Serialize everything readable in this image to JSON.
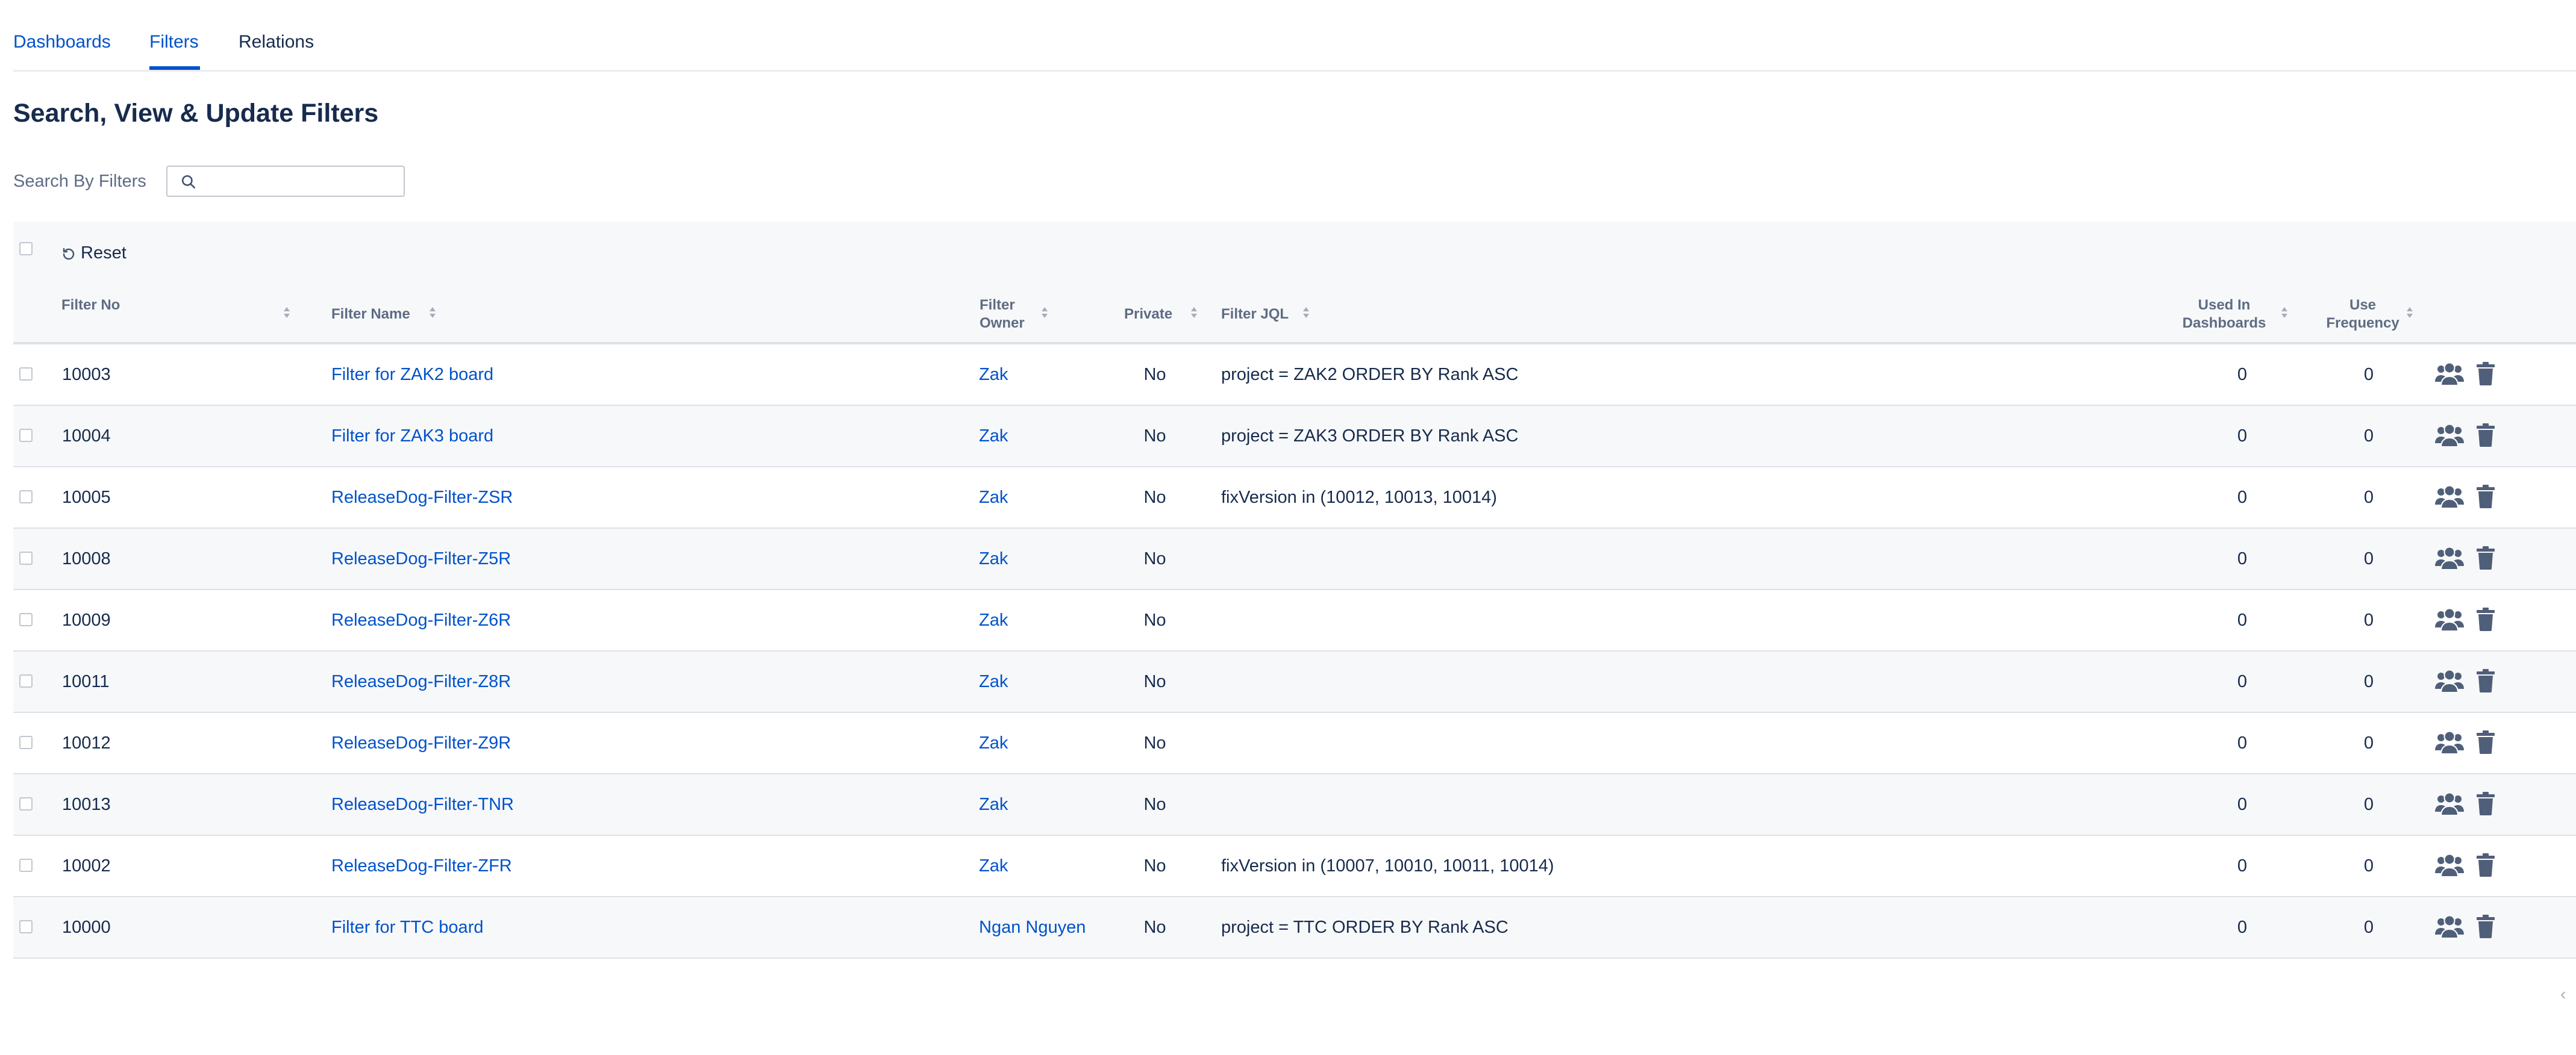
{
  "tabs": {
    "dashboards": "Dashboards",
    "filters": "Filters",
    "relations": "Relations"
  },
  "page_title": "Search, View & Update Filters",
  "search": {
    "label": "Search By Filters",
    "value": "",
    "placeholder": ""
  },
  "toolbar": {
    "reset_label": "Reset"
  },
  "columns": {
    "filter_no": "Filter No",
    "filter_name": "Filter Name",
    "filter_owner": "Filter Owner",
    "private": "Private",
    "filter_jql": "Filter JQL",
    "used_in_dashboards": "Used In Dashboards",
    "use_frequency": "Use Frequency"
  },
  "rows": [
    {
      "no": "10003",
      "name": "Filter for ZAK2 board",
      "owner": "Zak",
      "private": "No",
      "jql": "project = ZAK2 ORDER BY Rank ASC",
      "used": "0",
      "freq": "0"
    },
    {
      "no": "10004",
      "name": "Filter for ZAK3 board",
      "owner": "Zak",
      "private": "No",
      "jql": "project = ZAK3 ORDER BY Rank ASC",
      "used": "0",
      "freq": "0"
    },
    {
      "no": "10005",
      "name": "ReleaseDog-Filter-ZSR",
      "owner": "Zak",
      "private": "No",
      "jql": "fixVersion in (10012, 10013, 10014)",
      "used": "0",
      "freq": "0"
    },
    {
      "no": "10008",
      "name": "ReleaseDog-Filter-Z5R",
      "owner": "Zak",
      "private": "No",
      "jql": "",
      "used": "0",
      "freq": "0"
    },
    {
      "no": "10009",
      "name": "ReleaseDog-Filter-Z6R",
      "owner": "Zak",
      "private": "No",
      "jql": "",
      "used": "0",
      "freq": "0"
    },
    {
      "no": "10011",
      "name": "ReleaseDog-Filter-Z8R",
      "owner": "Zak",
      "private": "No",
      "jql": "",
      "used": "0",
      "freq": "0"
    },
    {
      "no": "10012",
      "name": "ReleaseDog-Filter-Z9R",
      "owner": "Zak",
      "private": "No",
      "jql": "",
      "used": "0",
      "freq": "0"
    },
    {
      "no": "10013",
      "name": "ReleaseDog-Filter-TNR",
      "owner": "Zak",
      "private": "No",
      "jql": "",
      "used": "0",
      "freq": "0"
    },
    {
      "no": "10002",
      "name": "ReleaseDog-Filter-ZFR",
      "owner": "Zak",
      "private": "No",
      "jql": "fixVersion in (10007, 10010, 10011, 10014)",
      "used": "0",
      "freq": "0"
    },
    {
      "no": "10000",
      "name": "Filter for TTC board",
      "owner": "Ngan Nguyen",
      "private": "No",
      "jql": "project = TTC ORDER BY Rank ASC",
      "used": "0",
      "freq": "0"
    }
  ],
  "icons": {
    "search": "search-icon",
    "reset": "undo-icon",
    "share": "people-icon",
    "delete": "trash-icon",
    "scroll_left": "chevron-left-icon"
  },
  "scroll_left_glyph": "‹",
  "colors": {
    "link": "#0052cc",
    "text": "#172b4d",
    "muted": "#5e6c84",
    "icon": "#505f79",
    "border": "#dfe1e6",
    "stripe": "#f7f8f9"
  }
}
